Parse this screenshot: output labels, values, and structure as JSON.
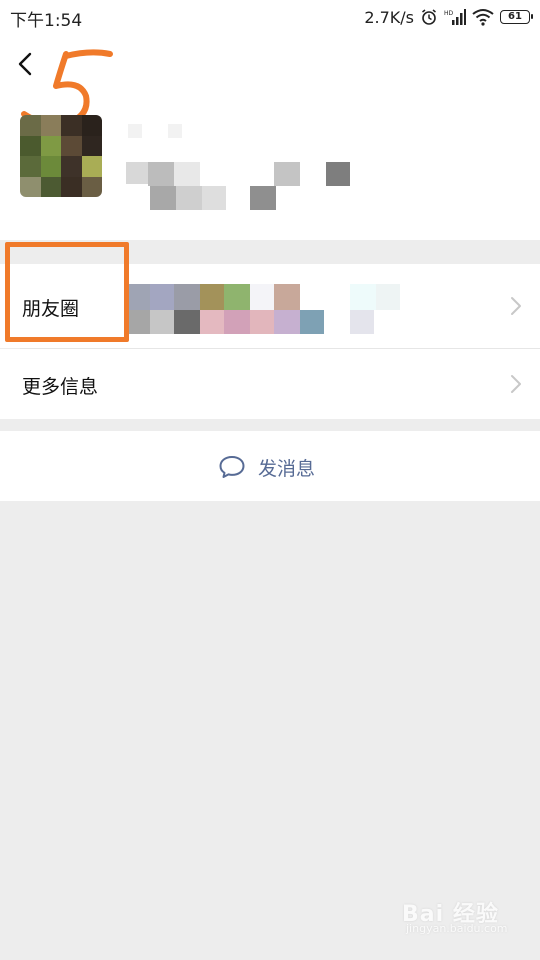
{
  "status_bar": {
    "time": "下午1:54",
    "network_speed": "2.7K/s",
    "battery_level": "61",
    "icons": [
      "alarm-icon",
      "hd-signal-icon",
      "wifi-icon",
      "battery-icon"
    ]
  },
  "header": {
    "back_icon": "chevron-left-icon"
  },
  "annotation": {
    "step_number": "5",
    "color": "#f07a2a"
  },
  "profile": {
    "avatar": "blurred-avatar",
    "name": "",
    "details": ""
  },
  "rows": {
    "moments_label": "朋友圈",
    "more_info_label": "更多信息",
    "chevron_icon": "chevron-right-icon"
  },
  "actions": {
    "send_message_label": "发消息",
    "send_message_icon": "chat-bubble-icon"
  },
  "watermark": {
    "brand": "Bai 经验",
    "url": "jingyan.baidu.com"
  },
  "colors": {
    "link_blue": "#576b95",
    "background": "#ededed",
    "annotation_orange": "#f07a2a"
  }
}
